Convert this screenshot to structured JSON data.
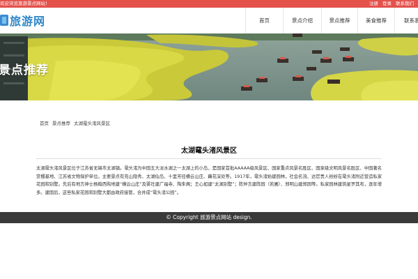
{
  "topbar": {
    "welcome": "欢迎浏览旅游景点网站！",
    "links": [
      "注册",
      "登录",
      "联系我们"
    ]
  },
  "header": {
    "logo_text": "旅游网",
    "nav": [
      "首页",
      "景点介绍",
      "景点推荐",
      "美食推荐",
      "联系我们"
    ]
  },
  "banner": {
    "title": "景点推荐"
  },
  "breadcrumb": [
    "首页",
    "景点推荐",
    "太湖鼋头渚风景区"
  ],
  "article": {
    "title": "太湖鼋头渚风景区",
    "body": "太湖鼋头渚风景区位于江苏省无锡市太湖镇。鼋头渚为中国五大淡水湖之一太湖上的小岛，是国家首批AAAAA级风景区、国家重点风景名胜区、国家级文明风景名胜区、中国著名赏樱基地、江苏省文物保护单位。主要景点有充山隐秀、太湖仙岛、十里芳径横云山庄、藕花深处等。1917年，鼋头渚始建园林，社会名流、达官贵人纷纷在鼋头渚附近营造私家花园和别墅。先后有地方绅士杨翰西购地建“横云山庄”及雾社建广福寺、陶朱阁；王心如建“太湖别墅”；陈仲言建陈园（若圃）、郑明山建郑园等。私家园林建筑星罗其布，逐年增多。建国后，这些私家花园和别墅大都由政府接管，合并成“鼋头渚公园”。"
  },
  "footer": {
    "copyright": "© Copyright 旅游景点网站 design."
  },
  "colors": {
    "topbar": "#e4514b",
    "logo": "#2e86c8",
    "footer": "#3a3a3a"
  }
}
